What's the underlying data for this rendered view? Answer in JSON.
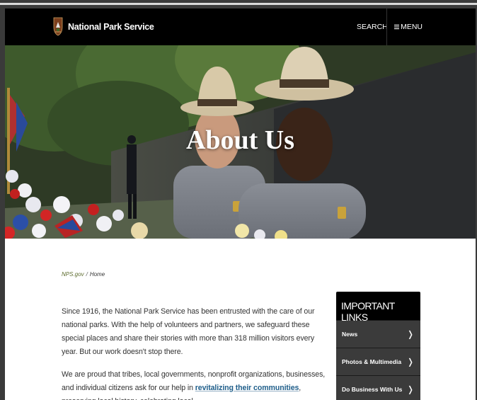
{
  "header": {
    "brand": "National Park Service",
    "search_label": "SEARCH",
    "menu_label": "MENU"
  },
  "hero": {
    "title": "About Us"
  },
  "breadcrumb": {
    "root": "NPS.gov",
    "separator": "/",
    "current": "Home"
  },
  "content": {
    "p1": "Since 1916, the National Park Service has been entrusted with the care of our national parks. With the help of volunteers and partners, we safeguard these special places and share their stories with more than 318 million visitors every year. But our work doesn't stop there.",
    "p2_before": "We are proud that tribes, local governments, nonprofit organizations, businesses, and individual citizens ask for our help in ",
    "p2_link": "revitalizing their communities",
    "p2_after": ", preserving local history, celebrating local"
  },
  "important_links": {
    "heading": "IMPORTANT LINKS",
    "items": [
      {
        "label": "News"
      },
      {
        "label": "Photos & Multimedia"
      },
      {
        "label": "Do Business With Us"
      }
    ]
  },
  "colors": {
    "header_bg": "#000000",
    "link_blue": "#1f5e8a",
    "breadcrumb_olive": "#5b6a2c",
    "sidebar_item_bg": "#3b3b3b"
  }
}
